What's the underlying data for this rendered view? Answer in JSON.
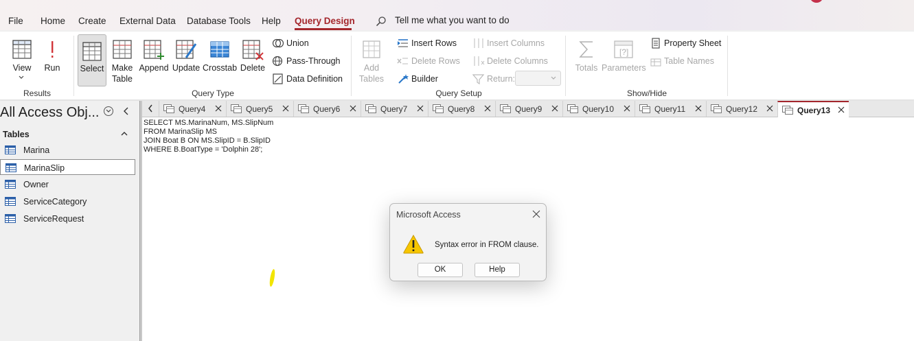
{
  "menu": {
    "items": [
      "File",
      "Home",
      "Create",
      "External Data",
      "Database Tools",
      "Help",
      "Query Design"
    ],
    "active": "Query Design",
    "tell_me": "Tell me what you want to do"
  },
  "ribbon": {
    "results": {
      "group": "Results",
      "view": "View",
      "run": "Run"
    },
    "query_type": {
      "group": "Query Type",
      "select": "Select",
      "make_table_1": "Make",
      "make_table_2": "Table",
      "append": "Append",
      "update": "Update",
      "crosstab": "Crosstab",
      "delete": "Delete",
      "union": "Union",
      "pass_through": "Pass-Through",
      "data_definition": "Data Definition"
    },
    "query_setup": {
      "group": "Query Setup",
      "add_tables_1": "Add",
      "add_tables_2": "Tables",
      "insert_rows": "Insert Rows",
      "delete_rows": "Delete Rows",
      "builder": "Builder",
      "insert_columns": "Insert Columns",
      "delete_columns": "Delete Columns",
      "return": "Return:"
    },
    "show_hide": {
      "group": "Show/Hide",
      "totals": "Totals",
      "parameters": "Parameters",
      "property_sheet": "Property Sheet",
      "table_names": "Table Names"
    }
  },
  "nav": {
    "title": "All Access Obj...",
    "section": "Tables",
    "tables": [
      "Marina",
      "MarinaSlip",
      "Owner",
      "ServiceCategory",
      "ServiceRequest"
    ],
    "selected": "MarinaSlip"
  },
  "tabs": [
    "Query4",
    "Query5",
    "Query6",
    "Query7",
    "Query8",
    "Query9",
    "Query10",
    "Query11",
    "Query12",
    "Query13"
  ],
  "active_tab": "Query13",
  "sql": [
    "SELECT MS.MarinaNum, MS.SlipNum",
    "FROM MarinaSlip MS",
    "JOIN Boat B ON MS.SlipID = B.SlipID",
    "WHERE B.BoatType = 'Dolphin 28';"
  ],
  "dialog": {
    "title": "Microsoft Access",
    "message": "Syntax error in FROM clause.",
    "ok": "OK",
    "help": "Help"
  },
  "colors": {
    "accent": "#a4262c",
    "warning": "#f7c600"
  }
}
